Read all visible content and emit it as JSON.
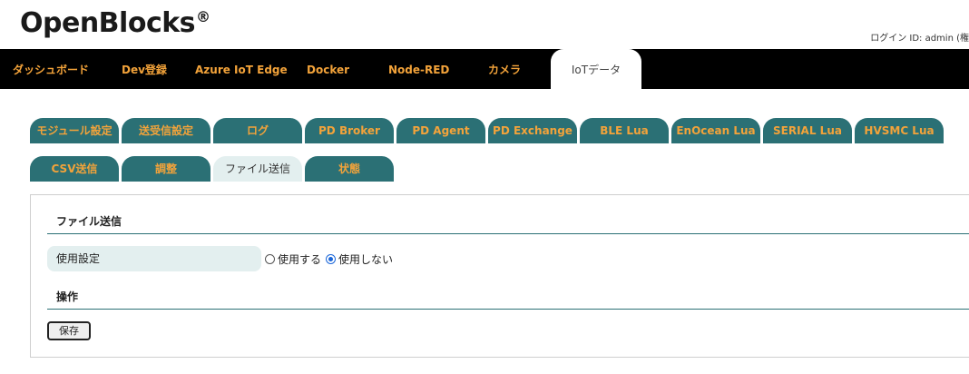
{
  "header": {
    "logo": "OpenBlocks",
    "logo_mark": "®",
    "login": "ログイン ID: admin (権"
  },
  "nav": {
    "items": [
      {
        "label": "ダッシュボード"
      },
      {
        "label": "Dev登録"
      },
      {
        "label": "Azure IoT Edge"
      },
      {
        "label": "Docker"
      },
      {
        "label": "Node-RED"
      },
      {
        "label": "カメラ"
      },
      {
        "label": "IoTデータ"
      }
    ],
    "active": "IoTデータ"
  },
  "tabs": {
    "row1": [
      "モジュール設定",
      "送受信設定",
      "ログ",
      "PD Broker",
      "PD Agent",
      "PD Exchange",
      "BLE Lua",
      "EnOcean Lua",
      "SERIAL Lua",
      "HVSMC Lua"
    ],
    "row2": [
      "CSV送信",
      "調整",
      "ファイル送信",
      "状態"
    ],
    "active": "ファイル送信"
  },
  "panel": {
    "section_title": "ファイル送信",
    "usage_label": "使用設定",
    "option_use": "使用する",
    "option_nouse": "使用しない",
    "selected": "使用しない",
    "ops_title": "操作",
    "save_label": "保存"
  },
  "colors": {
    "nav_bg": "#000000",
    "nav_text": "#f3a33a",
    "tab_bg": "#2b7075",
    "tab_active_bg": "#e3efef",
    "radio_selected": "#1a66d9"
  }
}
